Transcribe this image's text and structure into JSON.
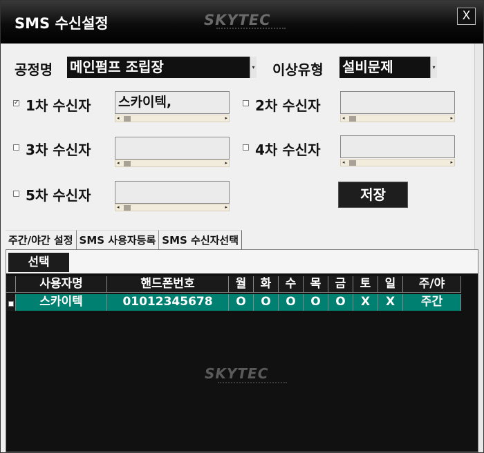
{
  "window": {
    "title": "SMS 수신설정",
    "logo": "SKYTEC",
    "close_label": "X"
  },
  "form": {
    "process_label": "공정명",
    "process_value": "메인펌프 조립장",
    "issue_label": "이상유형",
    "issue_value": "설비문제",
    "receivers": [
      {
        "checked": true,
        "label": "1차 수신자",
        "value": "스카이텍,"
      },
      {
        "checked": false,
        "label": "2차 수신자",
        "value": ""
      },
      {
        "checked": false,
        "label": "3차 수신자",
        "value": ""
      },
      {
        "checked": false,
        "label": "4차 수신자",
        "value": ""
      },
      {
        "checked": false,
        "label": "5차 수신자",
        "value": ""
      }
    ],
    "save_label": "저장"
  },
  "tabs": [
    "주간/야간 설정",
    "SMS 사용자등록",
    "SMS 수신자선택"
  ],
  "toolbar": {
    "select_label": "선택"
  },
  "grid": {
    "columns": [
      "사용자명",
      "핸드폰번호",
      "월",
      "화",
      "수",
      "목",
      "금",
      "토",
      "일",
      "주/야"
    ],
    "rows": [
      {
        "checked": false,
        "cells": [
          "스카이텍",
          "01012345678",
          "O",
          "O",
          "O",
          "O",
          "O",
          "X",
          "X",
          "주간"
        ]
      }
    ]
  },
  "colors": {
    "row_selected": "#008070",
    "title_bar": "#0c0c0c"
  }
}
